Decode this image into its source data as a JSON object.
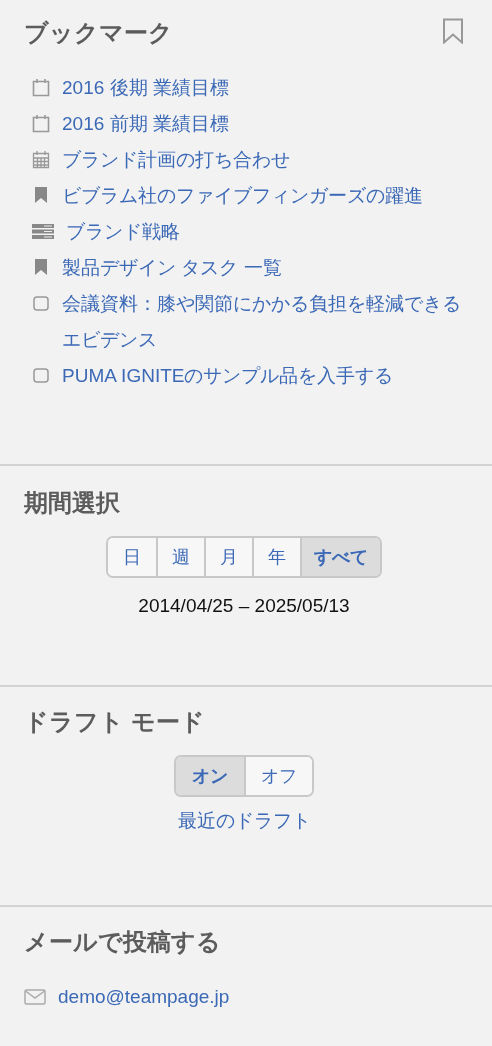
{
  "bookmarks": {
    "title": "ブックマーク",
    "items": [
      {
        "kind": "event",
        "label": "2016 後期 業績目標"
      },
      {
        "kind": "event",
        "label": "2016 前期 業績目標"
      },
      {
        "kind": "meeting",
        "label": "ブランド計画の打ち合わせ"
      },
      {
        "kind": "bookmark",
        "label": "ビブラム社のファイブフィンガーズの躍進"
      },
      {
        "kind": "wiki",
        "label": "ブランド戦略"
      },
      {
        "kind": "bookmark",
        "label": "製品デザイン タスク 一覧"
      },
      {
        "kind": "task",
        "label": "会議資料：膝や関節にかかる負担を軽減できるエビデンス"
      },
      {
        "kind": "task",
        "label": "PUMA IGNITEのサンプル品を入手する"
      }
    ]
  },
  "period": {
    "title": "期間選択",
    "tabs": [
      {
        "label": "日",
        "selected": false
      },
      {
        "label": "週",
        "selected": false
      },
      {
        "label": "月",
        "selected": false
      },
      {
        "label": "年",
        "selected": false
      },
      {
        "label": "すべて",
        "selected": true
      }
    ],
    "range": "2014/04/25 – 2025/05/13"
  },
  "draft": {
    "title": "ドラフト モード",
    "options": [
      {
        "label": "オン",
        "selected": true
      },
      {
        "label": "オフ",
        "selected": false
      }
    ],
    "link": "最近のドラフト"
  },
  "email": {
    "title": "メールで投稿する",
    "address": "demo@teampage.jp"
  }
}
